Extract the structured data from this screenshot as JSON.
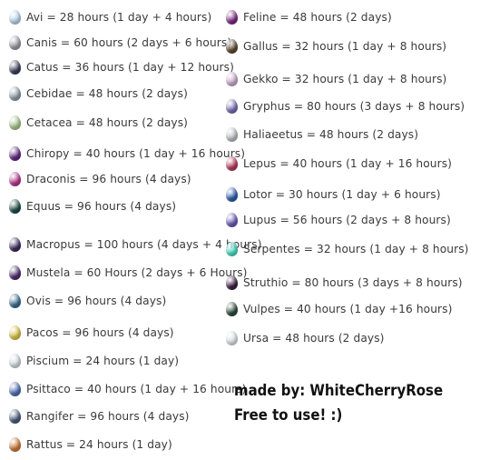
{
  "eggs_left": [
    {
      "label": "Avi = 28 hours (1 day + 4 hours)",
      "icon": "avi-egg-icon",
      "color": "#b9d3e6"
    },
    {
      "label": "Canis = 60 hours (2 days + 6 hours)",
      "icon": "canis-egg-icon",
      "color": "#9a9aa3"
    },
    {
      "label": "Catus = 36 hours (1 day + 12 hours)",
      "icon": "catus-egg-icon",
      "color": "#3c3f5a"
    },
    {
      "label": "Cebidae = 48 hours (2 days)",
      "icon": "cebidae-egg-icon",
      "color": "#8e9aa5"
    },
    {
      "label": "Cetacea = 48 hours (2 days)",
      "icon": "cetacea-egg-icon",
      "color": "#a6c48e"
    },
    {
      "label": "Chiropy = 40 hours (1 day + 16 hours)",
      "icon": "chiropy-egg-icon",
      "color": "#5e2a7e"
    },
    {
      "label": "Draconis = 96 hours (4 days)",
      "icon": "draconis-egg-icon",
      "color": "#b0388a"
    },
    {
      "label": "Equus = 96 hours (4 days)",
      "icon": "equus-egg-icon",
      "color": "#1c4a44"
    },
    {
      "label": "Macropus = 100 hours (4 days + 4 hours)",
      "icon": "macropus-egg-icon",
      "color": "#3b2a5a"
    },
    {
      "label": "Mustela = 60 Hours (2 days + 6 Hours)",
      "icon": "mustela-egg-icon",
      "color": "#4b2b6b"
    },
    {
      "label": "Ovis = 96 hours (4 days)",
      "icon": "ovis-egg-icon",
      "color": "#3a6d8e"
    },
    {
      "label": "Pacos = 96 hours (4 days)",
      "icon": "pacos-egg-icon",
      "color": "#d8c24a"
    },
    {
      "label": "Piscium = 24 hours (1 day)",
      "icon": "piscium-egg-icon",
      "color": "#cfd9de"
    },
    {
      "label": "Psittaco = 40 hours (1 day + 16 hours)",
      "icon": "psittaco-egg-icon",
      "color": "#4f6fb0"
    },
    {
      "label": "Rangifer = 96 hours (4 days)",
      "icon": "rangifer-egg-icon",
      "color": "#4a5a7a"
    },
    {
      "label": "Rattus = 24 hours (1 day)",
      "icon": "rattus-egg-icon",
      "color": "#c9793a"
    }
  ],
  "eggs_right": [
    {
      "label": "Feline = 48 hours (2 days)",
      "icon": "feline-egg-icon",
      "color": "#7a2a7e"
    },
    {
      "label": "Gallus = 32 hours (1 day + 8 hours)",
      "icon": "gallus-egg-icon",
      "color": "#5a4a2e"
    },
    {
      "label": "Gekko = 32 hours (1 day + 8 hours)",
      "icon": "gekko-egg-icon",
      "color": "#c7a7c9"
    },
    {
      "label": "Gryphus = 80 hours (3 days + 8 hours)",
      "icon": "gryphus-egg-icon",
      "color": "#7a6bb0"
    },
    {
      "label": "Haliaeetus = 48 hours (2 days)",
      "icon": "haliaeetus-egg-icon",
      "color": "#b8bcc0"
    },
    {
      "label": "Lepus = 40 hours (1 day + 16 hours)",
      "icon": "lepus-egg-icon",
      "color": "#b03a5a"
    },
    {
      "label": "Lotor = 30 hours (1 day + 6 hours)",
      "icon": "lotor-egg-icon",
      "color": "#2e5aa8"
    },
    {
      "label": "Lupus = 56 hours (2 days + 8 hours)",
      "icon": "lupus-egg-icon",
      "color": "#6a5ab0"
    },
    {
      "label": "Serpentes = 32 hours (1 day + 8 hours)",
      "icon": "serpentes-egg-icon",
      "color": "#4ad6c0"
    },
    {
      "label": "Struthio = 80 hours (3 days + 8 hours)",
      "icon": "struthio-egg-icon",
      "color": "#3a1e3e"
    },
    {
      "label": "Vulpes = 40 hours (1 day +16 hours)",
      "icon": "vulpes-egg-icon",
      "color": "#2a4a3a"
    },
    {
      "label": "Ursa = 48 hours (2 days)",
      "icon": "ursa-egg-icon",
      "color": "#d8dee0"
    }
  ],
  "credit": {
    "line1": "made by: WhiteCherryRose",
    "line2": "Free to use! :)"
  }
}
